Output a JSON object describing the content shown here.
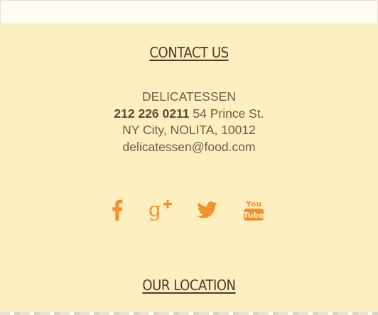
{
  "contact": {
    "title": "CONTACT US",
    "name": "DELICATESSEN",
    "phone": "212 226 0211",
    "street": "54 Prince St.",
    "city_line": "NY City, NOLITA, 10012",
    "email": "delicatessen@food.com"
  },
  "social": {
    "color": "#f0922f",
    "icons": [
      "facebook-icon",
      "google-plus-icon",
      "twitter-icon",
      "youtube-icon"
    ],
    "youtube_top": "You",
    "youtube_bottom": "Tube"
  },
  "location": {
    "title": "OUR LOCATION"
  }
}
